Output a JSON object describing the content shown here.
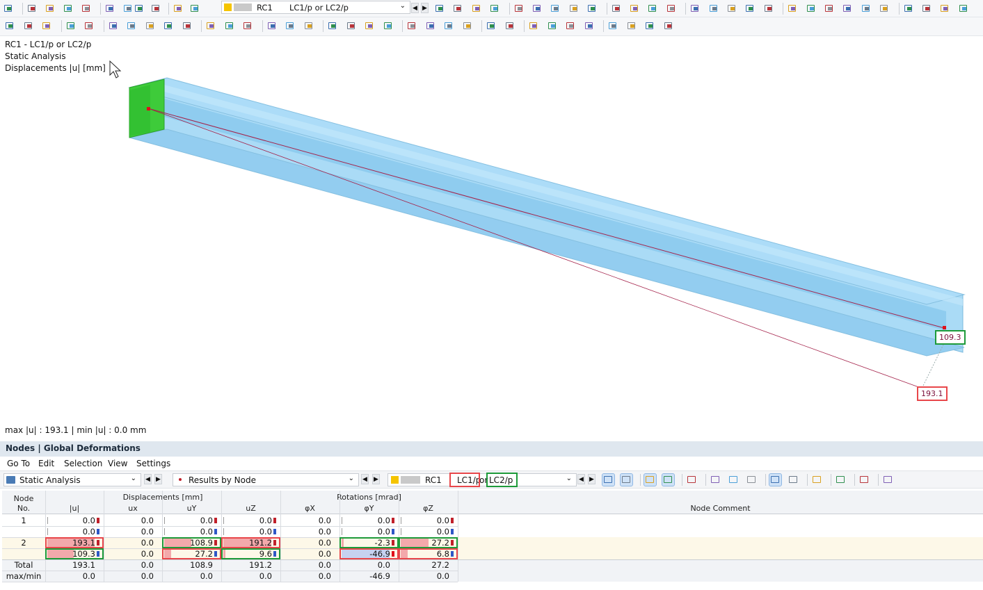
{
  "toolbar": {
    "row1_icons": [
      "display-modes-icon",
      "table-icon",
      "report-icon",
      "console-icon",
      "script-icon",
      "document-icon",
      "navigator-icon",
      "line-select-icon",
      "selection-icon",
      "copy-icon",
      "paste-icon",
      "load-case-color-icon",
      "prev-icon",
      "next-icon",
      "filter-icon",
      "view-icon",
      "numbering-icon",
      "deformation-icon",
      "numbering-xx-icon",
      "solid-icon",
      "grid-icon",
      "eye-icon",
      "result-values-icon",
      "dock-icon",
      "section-icon",
      "zoom-icon",
      "box-icon",
      "box-open-icon",
      "box-arrow-icon",
      "axis-x-icon",
      "axis-y-icon",
      "axis-z-icon",
      "axis-minus-x-icon",
      "view-rotate-icon",
      "plane-icon",
      "beam-icon",
      "scale-icon",
      "house-icon",
      "settings-icon"
    ],
    "row2_icons": [
      "camera-icon",
      "render-icon",
      "pointer-icon",
      "spark-icon",
      "member-icon",
      "member-grid-icon",
      "member-3d-icon",
      "coord-icon",
      "pin-icon",
      "funnel-icon",
      "rect-select-icon",
      "section-view-icon",
      "section-frame-icon",
      "deform-shape-icon",
      "surface-icon",
      "solid-box-icon",
      "arrow-icon",
      "line-icon",
      "spring-icon",
      "wave-icon",
      "release-icon",
      "stiffener-icon",
      "pen-icon",
      "marker-icon",
      "color-scale-icon",
      "mesh-icon",
      "target-icon",
      "diamond-icon",
      "cube-icon",
      "rotate-icon",
      "mirror-icon",
      "flip-icon",
      "close-icon",
      "camera2-icon"
    ],
    "case_combo": {
      "prefix": "RC1",
      "value": "LC1/p or LC2/p"
    }
  },
  "view": {
    "header_line1": "RC1 - LC1/p or LC2/p",
    "header_line2": "Static Analysis",
    "header_line3": "Displacements |u| [mm]",
    "status_text": "max |u| : 193.1 | min |u| : 0.0 mm",
    "label_green": "109.3",
    "label_red": "193.1"
  },
  "panel": {
    "title": "Nodes | Global Deformations",
    "menu": [
      "Go To",
      "Edit",
      "Selection",
      "View",
      "Settings"
    ],
    "analysis_combo": "Static Analysis",
    "results_combo": "Results by Node",
    "rc_label": "RC1",
    "lc1_label": "LC1/p",
    "or_label": "or",
    "lc2_label": "LC2/p"
  },
  "table": {
    "header_node": "Node",
    "header_no": "No.",
    "group_displacements": "Displacements [mm]",
    "group_rotations": "Rotations [mrad]",
    "col_u": "|u|",
    "col_ux": "ux",
    "col_uy": "uY",
    "col_uz": "uZ",
    "col_phix": "φX",
    "col_phiy": "φY",
    "col_phiz": "φZ",
    "col_comment": "Node Comment",
    "rows": [
      {
        "node": "1",
        "u": "0.0",
        "ux": "0.0",
        "uy": "0.0",
        "uz": "0.0",
        "phix": "0.0",
        "phiy": "0.0",
        "phiz": "0.0"
      },
      {
        "node": "",
        "u": "0.0",
        "ux": "0.0",
        "uy": "0.0",
        "uz": "0.0",
        "phix": "0.0",
        "phiy": "0.0",
        "phiz": "0.0"
      },
      {
        "node": "2",
        "u": "193.1",
        "ux": "0.0",
        "uy": "108.9",
        "uz": "191.2",
        "phix": "0.0",
        "phiy": "-2.3",
        "phiz": "27.2"
      },
      {
        "node": "",
        "u": "109.3",
        "ux": "0.0",
        "uy": "27.2",
        "uz": "9.6",
        "phix": "0.0",
        "phiy": "-46.9",
        "phiz": "6.8"
      },
      {
        "node": "Total",
        "u": "193.1",
        "ux": "0.0",
        "uy": "108.9",
        "uz": "191.2",
        "phix": "0.0",
        "phiy": "0.0",
        "phiz": "27.2"
      },
      {
        "node": "max/min",
        "u": "0.0",
        "ux": "0.0",
        "uy": "0.0",
        "uz": "0.0",
        "phix": "0.0",
        "phiy": "-46.9",
        "phiz": "0.0"
      }
    ]
  },
  "colors": {
    "beam": "#8ecdf0",
    "highlight_red": "#e8464a",
    "highlight_green": "#1d9a39",
    "support": "#39c43a",
    "row_highlight": "#fdf8e8"
  }
}
